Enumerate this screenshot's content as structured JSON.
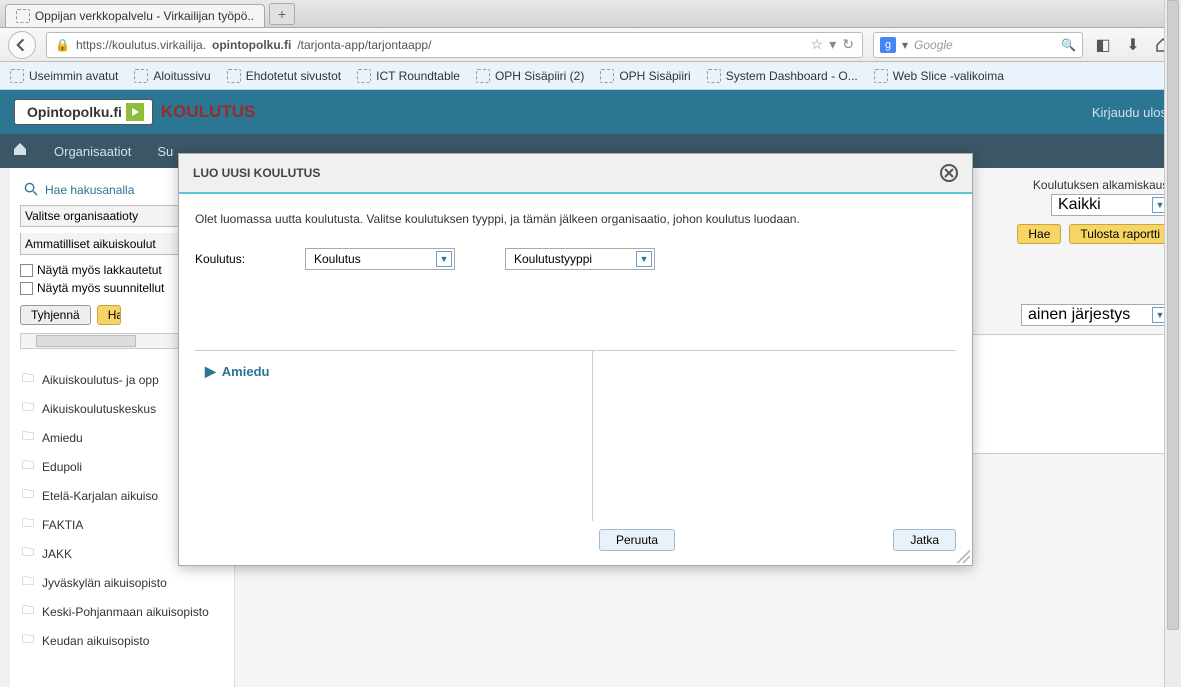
{
  "browser": {
    "tab_title": "Oppijan verkkopalvelu - Virkailijan työpö...",
    "url_prefix": "https://koulutus.virkailija.",
    "url_bold": "opintopolku.fi",
    "url_suffix": "/tarjonta-app/tarjontaapp/",
    "search_placeholder": "Google",
    "bookmarks": [
      "Useimmin avatut",
      "Aloitussivu",
      "Ehdotetut sivustot",
      "ICT Roundtable",
      "OPH Sisäpiiri (2)",
      "OPH Sisäpiiri",
      "System Dashboard - O...",
      "Web Slice -valikoima"
    ]
  },
  "header": {
    "logo_text": "Opintopolku.fi",
    "app_title": "KOULUTUS",
    "logout": "Kirjaudu ulos"
  },
  "nav": {
    "org": "Organisaatiot",
    "other_prefix": "Su"
  },
  "left": {
    "search_label": "Hae hakusanalla",
    "org_select": "Valitse organisaatioty",
    "edu_select": "Ammatilliset aikuiskoulut",
    "cb1": "Näytä myös lakkautetut",
    "cb2": "Näytä myös suunnitellut",
    "btn_clear": "Tyhjennä",
    "btn_search": "Ha",
    "folders": [
      "Aikuiskoulutus- ja opp",
      "Aikuiskoulutuskeskus",
      "Amiedu",
      "Edupoli",
      "Etelä-Karjalan aikuiso",
      "FAKTIA",
      "JAKK",
      "Jyväskylän aikuisopisto",
      "Keski-Pohjanmaan aikuisopisto",
      "Keudan aikuisopisto"
    ]
  },
  "right": {
    "season_label": "Koulutuksen alkamiskausi",
    "season_value": "Kaikki",
    "btn_search": "Hae",
    "btn_report": "Tulosta raportti",
    "sort_label": "ainen järjestys"
  },
  "modal": {
    "title": "LUO UUSI KOULUTUS",
    "intro": "Olet luomassa uutta koulutusta. Valitse koulutuksen tyyppi, ja tämän jälkeen organisaatio, johon koulutus luodaan.",
    "form_label": "Koulutus:",
    "select1": "Koulutus",
    "select2": "Koulutustyyppi",
    "org": "Amiedu",
    "btn_cancel": "Peruuta",
    "btn_continue": "Jatka"
  }
}
